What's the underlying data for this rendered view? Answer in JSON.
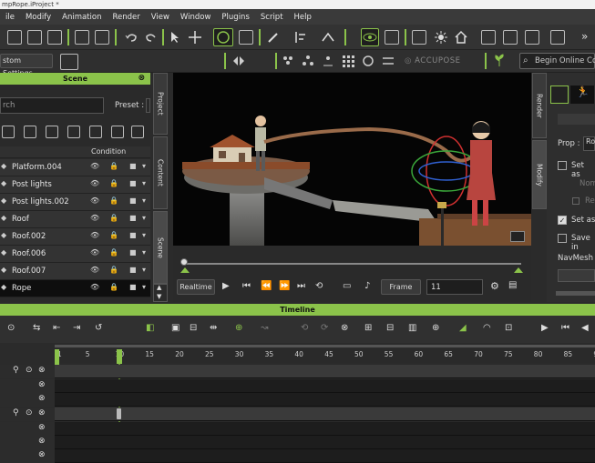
{
  "title_bar": "mpRope.iProject *",
  "menu": [
    "ile",
    "Modify",
    "Animation",
    "Render",
    "View",
    "Window",
    "Plugins",
    "Script",
    "Help"
  ],
  "toolbar2": {
    "settings_label": "stom Settings",
    "accupose_label": "ACCUPOSE",
    "search_placeholder": "Begin Online Co"
  },
  "scene": {
    "title": "Scene",
    "search_placeholder": "rch",
    "preset_label": "Preset :",
    "condition_header": "Condition",
    "items": [
      {
        "label": "Platform.004"
      },
      {
        "label": "Post lights"
      },
      {
        "label": "Post lights.002"
      },
      {
        "label": "Roof"
      },
      {
        "label": "Roof.002"
      },
      {
        "label": "Roof.006"
      },
      {
        "label": "Roof.007"
      },
      {
        "label": "Rope"
      }
    ]
  },
  "side_tabs": [
    "Project",
    "Content",
    "Scene"
  ],
  "right_tabs": [
    "Render",
    "Modify"
  ],
  "right_panel": {
    "prop_label": "Prop :",
    "prop_value": "Ro",
    "set_as_label": "Set as",
    "nom_label": "Nom",
    "re_label": "Re",
    "set_as_s_label": "Set as S",
    "save_in_label": "Save in",
    "navmesh_label": "NavMesh :"
  },
  "playback": {
    "realtime_label": "Realtime",
    "frame_mode": "Frame",
    "frame_value": "11"
  },
  "timeline": {
    "title": "Timeline",
    "ruler_ticks": [
      "1",
      "5",
      "10",
      "15",
      "20",
      "25",
      "30",
      "35",
      "40",
      "45",
      "50",
      "55",
      "60",
      "65",
      "70",
      "75",
      "80",
      "85",
      "90"
    ]
  },
  "colors": {
    "accent": "#8bc34a",
    "panel_bg": "#2a2a2a",
    "selected_row": "#0e0e0e"
  }
}
